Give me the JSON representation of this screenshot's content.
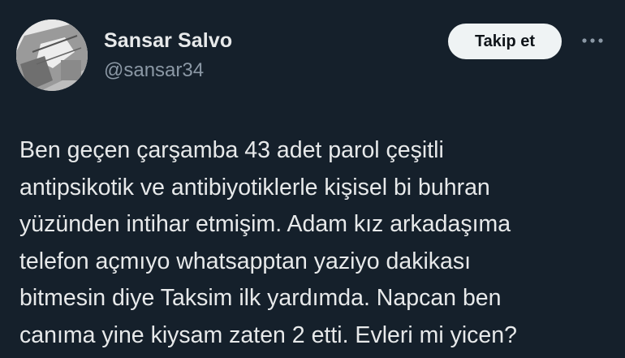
{
  "author": {
    "display_name": "Sansar Salvo",
    "handle": "@sansar34"
  },
  "actions": {
    "follow_label": "Takip et",
    "more_icon": "more-horizontal-icon"
  },
  "tweet": {
    "lines": [
      "Ben geçen çarşamba 43 adet parol çeşitli",
      "antipsikotik ve antibiyotiklerle kişisel bi buhran",
      "yüzünden intihar etmişim. Adam kız arkadaşıma",
      "telefon açmıyo whatsapptan yaziyo dakikası",
      "bitmesin diye Taksim ilk yardımda. Napcan ben",
      "canıma yine kiysam zaten 2 etti. Evleri mi yicen?"
    ]
  },
  "colors": {
    "background": "#15202b",
    "text_primary": "#e7e9ea",
    "text_secondary": "#8b98a5",
    "button_bg": "#eff3f4",
    "button_text": "#0f1419"
  }
}
